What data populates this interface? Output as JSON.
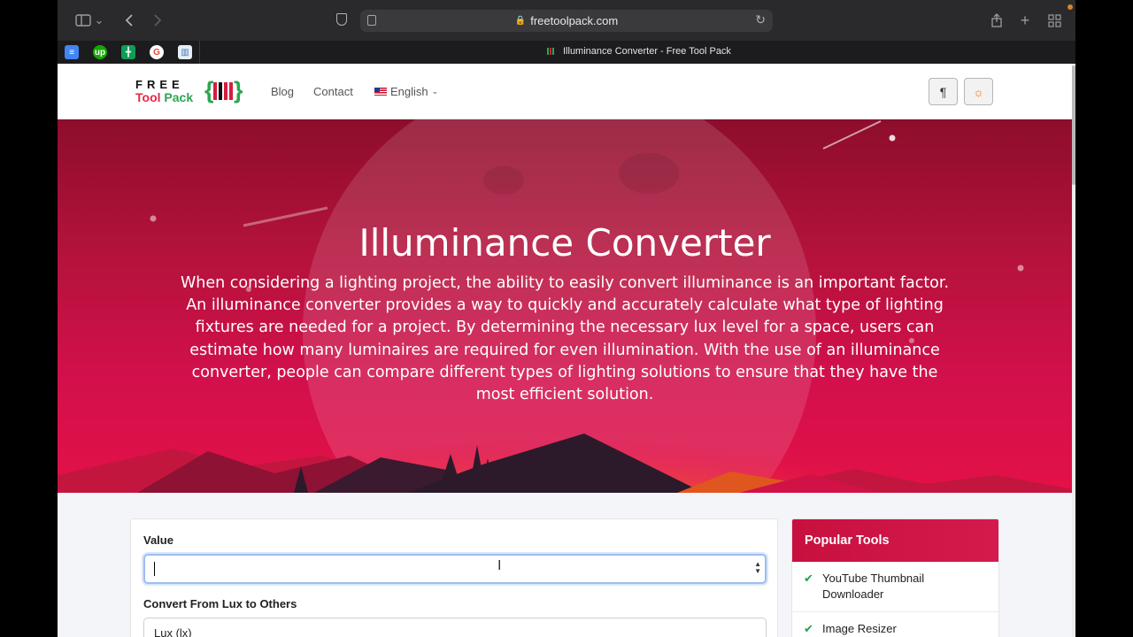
{
  "browser": {
    "url": "freetoolpack.com",
    "tab_title": "Illuminance Converter - Free Tool Pack",
    "favorites": [
      "docs-icon",
      "upwork-icon",
      "sheets-icon",
      "google-icon",
      "chart-icon"
    ],
    "favorite_upwork_text": "up"
  },
  "nav": {
    "logo_free": "FREE",
    "logo_tool": "Tool",
    "logo_pack": "Pack",
    "links": [
      "Blog",
      "Contact"
    ],
    "language": "English"
  },
  "hero": {
    "title": "Illuminance Converter",
    "description": "When considering a lighting project, the ability to easily convert illuminance is an important factor. An illuminance converter provides a way to quickly and accurately calculate what type of lighting fixtures are needed for a project. By determining the necessary lux level for a space, users can estimate how many luminaires are required for even illumination. With the use of an illuminance converter, people can compare different types of lighting solutions to ensure that they have the most efficient solution."
  },
  "converter": {
    "value_label": "Value",
    "value_input": "",
    "convert_label": "Convert From Lux to Others",
    "unit_selected": "Lux (lx)"
  },
  "sidebar": {
    "title": "Popular Tools",
    "items": [
      "YouTube Thumbnail Downloader",
      "Image Resizer"
    ]
  },
  "colors": {
    "brand_red": "#d41a4c",
    "brand_green": "#2ea44f",
    "check_green": "#22a34b"
  }
}
